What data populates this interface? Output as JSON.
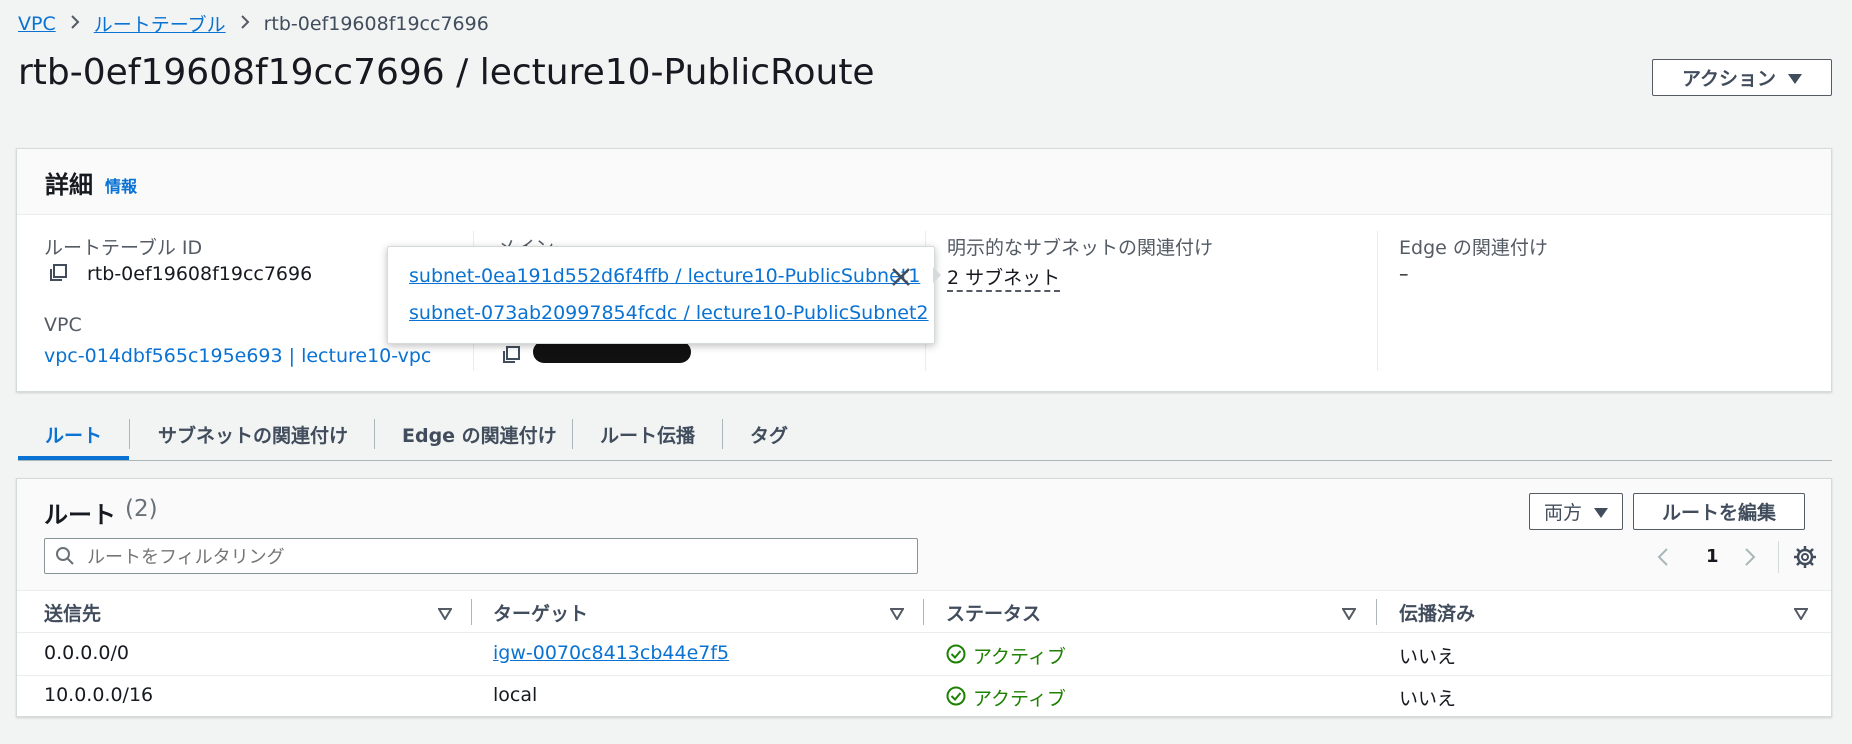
{
  "breadcrumb": [
    "VPC",
    "ルートテーブル",
    "rtb-0ef19608f19cc7696"
  ],
  "title": "rtb-0ef19608f19cc7696 / lecture10-PublicRoute",
  "actions_button": "アクション",
  "details": {
    "heading": "詳細",
    "info_link": "情報",
    "route_table_id_label": "ルートテーブル ID",
    "route_table_id": "rtb-0ef19608f19cc7696",
    "vpc_label": "VPC",
    "vpc_value": "vpc-014dbf565c195e693 | lecture10-vpc",
    "main_label": "メイン",
    "explicit_subnet_label": "明示的なサブネットの関連付け",
    "explicit_subnet_value": "2 サブネット",
    "edge_label": "Edge の関連付け",
    "edge_value": "–"
  },
  "popover": {
    "subnets": [
      "subnet-0ea191d552d6f4ffb / lecture10-PublicSubnet1",
      "subnet-073ab20997854fcdc / lecture10-PublicSubnet2"
    ]
  },
  "tabs": [
    "ルート",
    "サブネットの関連付け",
    "Edge の関連付け",
    "ルート伝播",
    "タグ"
  ],
  "routes": {
    "heading": "ルート",
    "count": "(2)",
    "both_button": "両方",
    "edit_button": "ルートを編集",
    "filter_placeholder": "ルートをフィルタリング",
    "page": "1",
    "columns": [
      "送信先",
      "ターゲット",
      "ステータス",
      "伝播済み"
    ],
    "rows": [
      {
        "dest": "0.0.0.0/0",
        "target": "igw-0070c8413cb44e7f5",
        "status": "アクティブ",
        "propagated": "いいえ"
      },
      {
        "dest": "10.0.0.0/16",
        "target": "local",
        "status": "アクティブ",
        "propagated": "いいえ"
      }
    ]
  },
  "colors": {
    "link": "#0972d3",
    "success": "#1d8102",
    "background": "#f2f3f3"
  }
}
